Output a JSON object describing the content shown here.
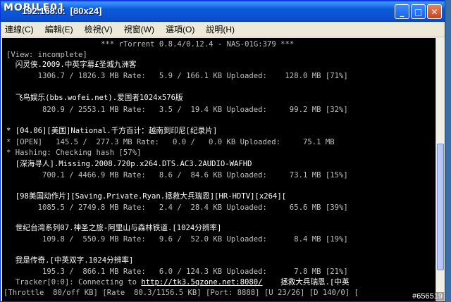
{
  "window": {
    "logo": "MOBILE01",
    "title": "192.168.0.  [80x24]",
    "controls": [
      "_",
      "□",
      "✕"
    ]
  },
  "menu": [
    "連線(C)",
    "編輯(E)",
    "檢視(V)",
    "視窗(W)",
    "選項(O)",
    "說明(H)"
  ],
  "terminal": {
    "header": "*** rTorrent 0.8.4/0.12.4 - NAS-01G:379 ***",
    "view": "[View: incomplete]",
    "torrents": [
      {
        "name": "  闪灵侠.2009.中英字幕£圣城九洲客",
        "stats": "       1306.7 / 1826.3 MB Rate:   5.9 / 166.1 KB Uploaded:    128.0 MB [71%]"
      },
      {
        "name": "  飞鸟娱乐(bbs.wofei.net).爱国者1024x576版",
        "stats": "        820.9 / 2553.1 MB Rate:   3.5 /  19.4 KB Uploaded:     99.2 MB [32%]"
      },
      {
        "name": "* [04.06][美国]National.千方百计：越南到印尼[纪录片]",
        "stats": "* [OPEN]   145.5 /  277.3 MB Rate:   0.0 /   0.0 KB Uploaded:     75.1 MB",
        "extra": "* Hashing: Checking hash [57%]"
      },
      {
        "name": "  [深海寻人].Missing.2008.720p.x264.DTS.AC3.2AUDIO-WAFHD",
        "stats": "        700.1 / 4466.9 MB Rate:   8.6 /  84.6 KB Uploaded:     73.1 MB [15%]"
      },
      {
        "name": "  [98美国动作片][Saving.Private.Ryan.拯救大兵瑞恩][HR-HDTV][x264][",
        "stats": "       1085.5 / 2749.8 MB Rate:   2.4 /  28.4 KB Uploaded:     65.6 MB [39%]"
      },
      {
        "name": "  世纪台湾系列07.神圣之旅-阿里山与森林铁道.[1024分辨率]",
        "stats": "        109.8 /  550.9 MB Rate:   9.6 /  52.0 KB Uploaded:      8.4 MB [19%]"
      },
      {
        "name": "  我是传奇.[中英双字.1024分辨率]",
        "stats": "        195.3 /  866.1 MB Rate:   6.0 / 124.3 KB Uploaded:      7.8 MB [21%]"
      }
    ],
    "tracker_prefix": "  Tracker[0:0]: Connecting to ",
    "tracker_url": "http://tk3.5qzone.net:8080/",
    "tracker_suffix": "    拯救大兵瑞恩.[中英",
    "status_bar": "[Throttle  80/off KB] [Rate  80.3/1156.5 KB] [Port: 8888] [U 23/26] [D 140/0] [",
    "watermark": "#656519"
  }
}
